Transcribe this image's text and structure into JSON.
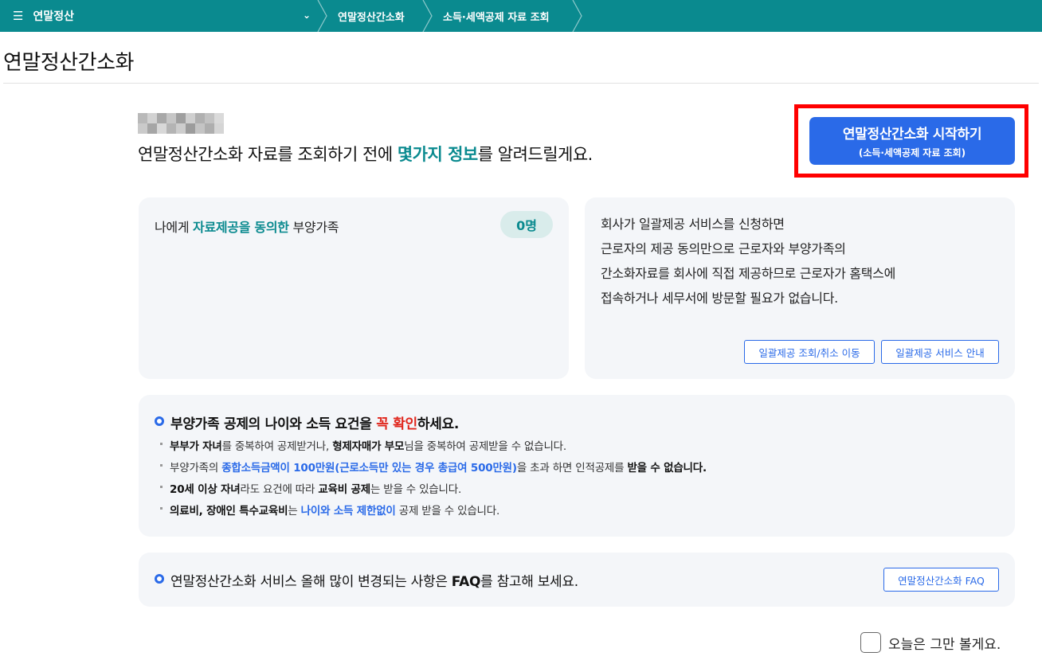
{
  "nav": {
    "menu_title": "연말정산",
    "breadcrumbs": [
      "연말정산간소화",
      "소득·세액공제 자료 조회"
    ]
  },
  "page": {
    "title": "연말정산간소화"
  },
  "intro": {
    "before": "연말정산간소화 자료를 조회하기 전에 ",
    "highlight": "몇가지 정보",
    "after": "를 알려드릴게요."
  },
  "start_button": {
    "main": "연말정산간소화 시작하기",
    "sub": "(소득·세액공제 자료 조회)"
  },
  "dependents": {
    "prefix": "나에게 ",
    "highlight": "자료제공을 동의한",
    "suffix": " 부양가족",
    "count": "0명"
  },
  "bulk_service": {
    "lines": [
      "회사가 일괄제공 서비스를 신청하면",
      "근로자의 제공 동의만으로 근로자와 부양가족의",
      "간소화자료를 회사에 직접 제공하므로 근로자가 홈택스에",
      "접속하거나 세무서에 방문할 필요가 없습니다."
    ],
    "query_button": "일괄제공 조회/취소 이동",
    "guide_button": "일괄제공 서비스 안내"
  },
  "notice": {
    "title_pre": "부양가족 공제의 나이와 소득 요건을 ",
    "title_red": "꼭 확인",
    "title_post": "하세요.",
    "items": [
      [
        {
          "t": "부부가 자녀",
          "s": "b"
        },
        {
          "t": "를 중복하여 공제받거나, ",
          "s": ""
        },
        {
          "t": "형제자매가 부모",
          "s": "b"
        },
        {
          "t": "님을 중복하여 공제받을 수 없습니다.",
          "s": ""
        }
      ],
      [
        {
          "t": "부양가족의 ",
          "s": ""
        },
        {
          "t": "종합소득금액이 100만원(근로소득만 있는 경우 총급여 500만원)",
          "s": "blue"
        },
        {
          "t": "을 초과 하면 인적공제를 ",
          "s": ""
        },
        {
          "t": "받을 수 없습니다.",
          "s": "b"
        }
      ],
      [
        {
          "t": "20세 이상 자녀",
          "s": "b"
        },
        {
          "t": "라도 요건에 따라 ",
          "s": ""
        },
        {
          "t": "교육비 공제",
          "s": "b"
        },
        {
          "t": "는 받을 수 있습니다.",
          "s": ""
        }
      ],
      [
        {
          "t": "의료비, 장애인 특수교육비",
          "s": "b"
        },
        {
          "t": "는 ",
          "s": ""
        },
        {
          "t": "나이와 소득 제한없이",
          "s": "blue"
        },
        {
          "t": " 공제 받을 수 있습니다.",
          "s": ""
        }
      ]
    ]
  },
  "faq": {
    "text_pre": "연말정산간소화 서비스 올해 많이 변경되는 사항은 ",
    "text_bold": "FAQ",
    "text_post": "를 참고해 보세요.",
    "button": "연말정산간소화 FAQ"
  },
  "dismiss": {
    "label": "오늘은 그만 볼게요."
  },
  "colors": {
    "brand_teal": "#0a8a8f",
    "accent_blue": "#2a6ae8",
    "highlight_red": "#e0261c",
    "card_bg": "#f4f6f9"
  },
  "icons": {
    "menu": "hamburger-icon",
    "dropdown": "chevron-down-icon",
    "bullet": "circle-bullet-icon"
  }
}
